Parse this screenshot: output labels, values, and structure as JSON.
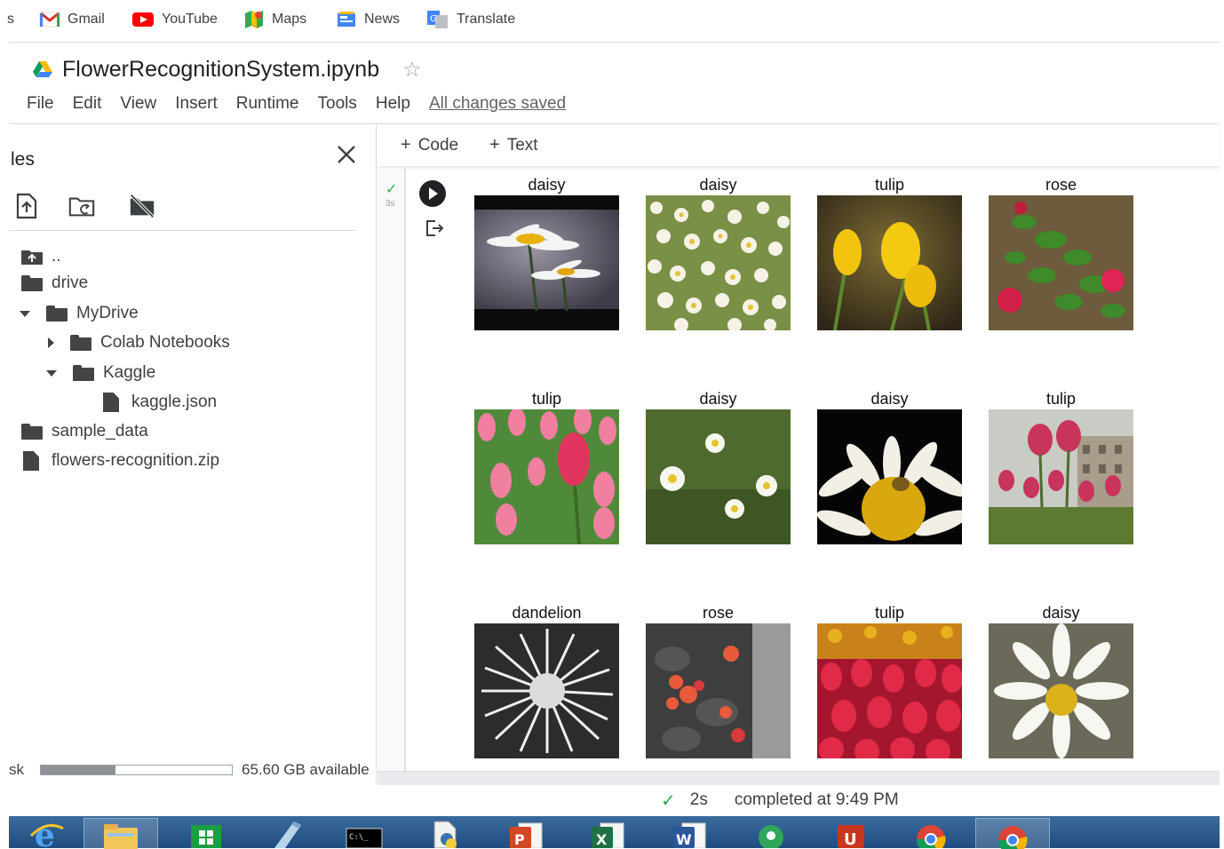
{
  "bookmarks": [
    {
      "label": "Gmail",
      "icon": "gmail-icon",
      "color": "#d93025"
    },
    {
      "label": "YouTube",
      "icon": "youtube-icon",
      "color": "#ff0000"
    },
    {
      "label": "Maps",
      "icon": "maps-icon",
      "color": "#34a853"
    },
    {
      "label": "News",
      "icon": "news-icon",
      "color": "#4285f4"
    },
    {
      "label": "Translate",
      "icon": "translate-icon",
      "color": "#4285f4"
    }
  ],
  "bookmark_cutoff": "s",
  "notebook": {
    "title": "FlowerRecognitionSystem.ipynb",
    "star": "☆",
    "menu": [
      "File",
      "Edit",
      "View",
      "Insert",
      "Runtime",
      "Tools",
      "Help"
    ],
    "save_status": "All changes saved"
  },
  "sidebar": {
    "title": "les",
    "close_icon": "close-icon",
    "tree": [
      {
        "label": "..",
        "type": "folder-up"
      },
      {
        "label": "drive",
        "type": "folder"
      },
      {
        "label": "MyDrive",
        "type": "folder",
        "expanded": true
      },
      {
        "label": "Colab Notebooks",
        "type": "folder",
        "expanded": false
      },
      {
        "label": "Kaggle",
        "type": "folder",
        "expanded": true
      },
      {
        "label": "kaggle.json",
        "type": "file"
      },
      {
        "label": "sample_data",
        "type": "folder"
      },
      {
        "label": "flowers-recognition.zip",
        "type": "file"
      }
    ],
    "disk_label": "sk",
    "disk_used_fraction": 0.39,
    "disk_available": "65.60 GB available"
  },
  "toolbar": {
    "code_label": "Code",
    "text_label": "Text"
  },
  "cell": {
    "exec_time": "3s",
    "flowers": [
      {
        "label": "daisy"
      },
      {
        "label": "daisy"
      },
      {
        "label": "tulip"
      },
      {
        "label": "rose"
      },
      {
        "label": "tulip"
      },
      {
        "label": "daisy"
      },
      {
        "label": "daisy"
      },
      {
        "label": "tulip"
      },
      {
        "label": "dandelion"
      },
      {
        "label": "rose"
      },
      {
        "label": "tulip"
      },
      {
        "label": "daisy"
      }
    ]
  },
  "status": {
    "duration": "2s",
    "completed": "completed at 9:49 PM"
  },
  "taskbar": {
    "apps": [
      "internet-explorer-icon",
      "file-explorer-icon",
      "store-icon",
      "paint-icon",
      "command-prompt-icon",
      "python-file-icon",
      "powerpoint-icon",
      "excel-icon",
      "word-icon",
      "maps-app-icon",
      "jupyter-icon",
      "chrome-icon",
      "chrome-active-icon"
    ]
  }
}
